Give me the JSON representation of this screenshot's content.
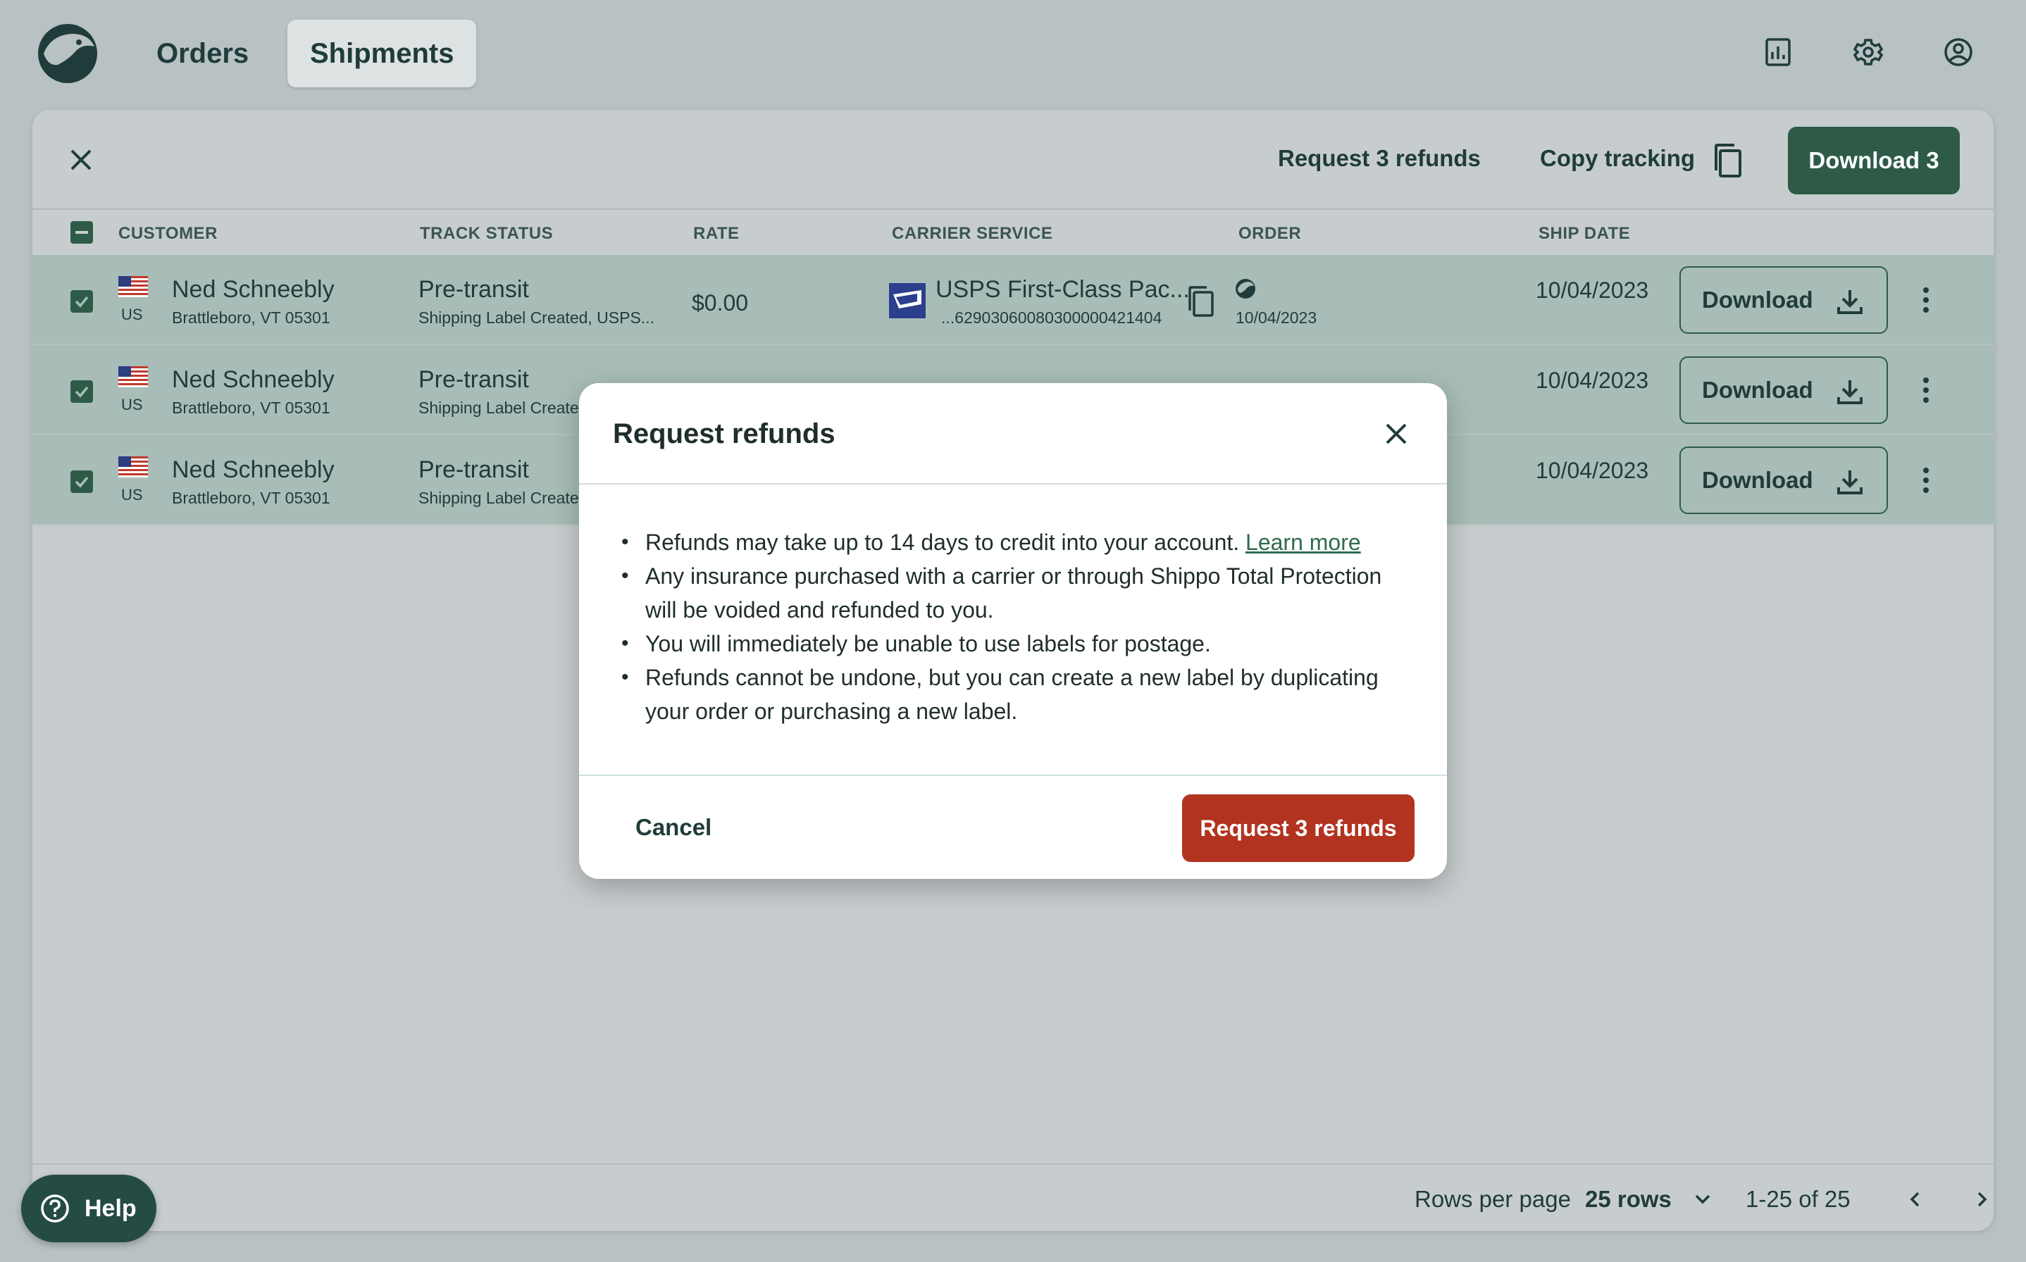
{
  "nav": {
    "logo_icon": "shippo-penguin-logo",
    "tabs": [
      "Orders",
      "Shipments"
    ],
    "active_tab": "Shipments",
    "icons": [
      "reports-icon",
      "gear-icon",
      "account-icon"
    ]
  },
  "bulk_bar": {
    "close_icon": "close-icon",
    "request_refunds": "Request 3 refunds",
    "copy_tracking": "Copy tracking",
    "download": "Download 3"
  },
  "table": {
    "columns": [
      "CUSTOMER",
      "TRACK STATUS",
      "RATE",
      "CARRIER SERVICE",
      "ORDER",
      "SHIP DATE"
    ],
    "rows": [
      {
        "country": "US",
        "name": "Ned Schneebly",
        "address": "Brattleboro, VT 05301",
        "status": "Pre-transit",
        "status_detail": "Shipping Label Created, USPS...",
        "rate": "$0.00",
        "carrier": "USPS First-Class Pac...",
        "tracking": "...62903060080300000421404",
        "order_date": "10/04/2023",
        "ship_date": "10/04/2023",
        "download": "Download"
      },
      {
        "country": "US",
        "name": "Ned Schneebly",
        "address": "Brattleboro, VT 05301",
        "status": "Pre-transit",
        "status_detail": "Shipping Label Create",
        "ship_date": "10/04/2023",
        "download": "Download"
      },
      {
        "country": "US",
        "name": "Ned Schneebly",
        "address": "Brattleboro, VT 05301",
        "status": "Pre-transit",
        "status_detail": "Shipping Label Create",
        "ship_date": "10/04/2023",
        "download": "Download"
      }
    ]
  },
  "pagination": {
    "rows_per_page_label": "Rows per page",
    "rows_value": "25 rows",
    "range": "1-25 of 25"
  },
  "help": {
    "label": "Help"
  },
  "modal": {
    "title": "Request refunds",
    "bullet1": "Refunds may take up to 14 days to credit into your account.",
    "learn_more": "Learn more",
    "bullet2": "Any insurance purchased with a carrier or through Shippo Total Protection will be voided and refunded to you.",
    "bullet3": "You will immediately be unable to use labels for postage.",
    "bullet4": "Refunds cannot be undone, but you can create a new label by duplicating your order or purchasing a new label.",
    "cancel": "Cancel",
    "confirm": "Request 3 refunds"
  },
  "colors": {
    "primary_green": "#2d5b48",
    "danger_red": "#b2331f",
    "selected_row": "#a8bdb7",
    "link_green": "#2f6b4f"
  }
}
